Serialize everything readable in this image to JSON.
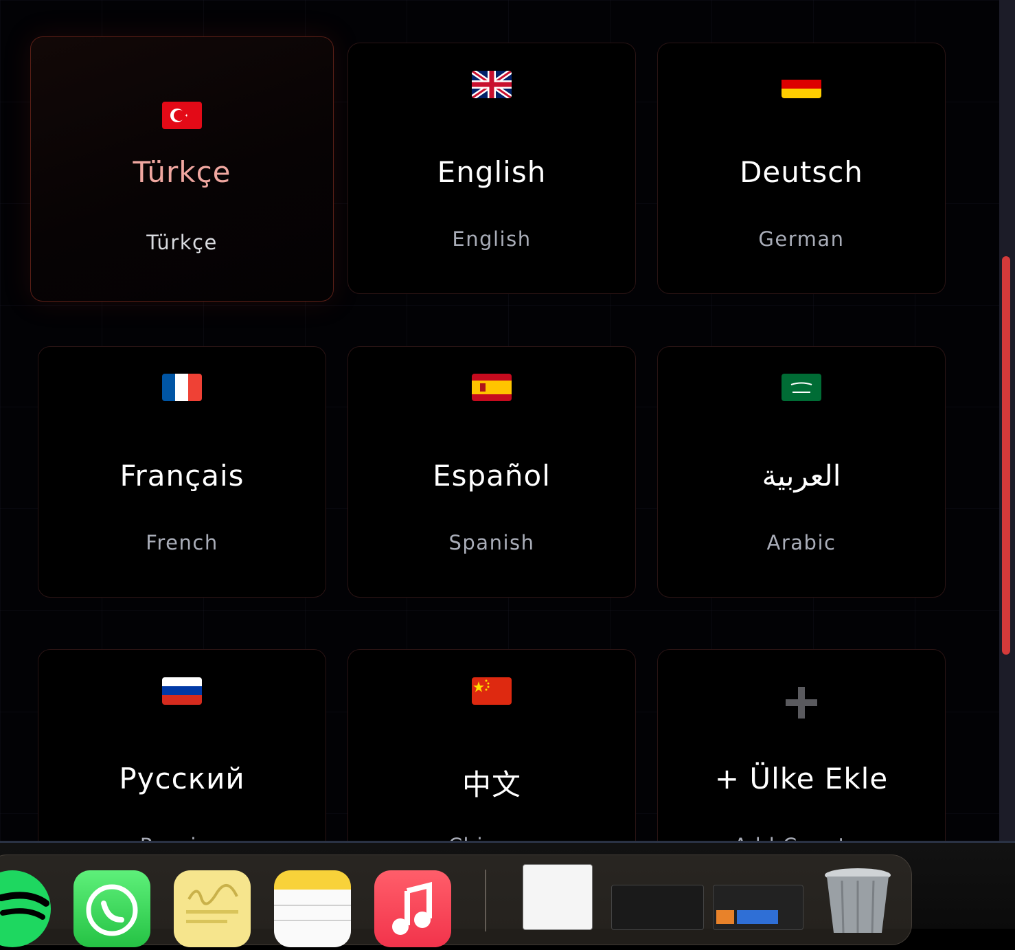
{
  "languages": [
    {
      "name": "Türkçe",
      "sub": "Türkçe",
      "flag": "turkey-flag-icon",
      "selected": true
    },
    {
      "name": "English",
      "sub": "English",
      "flag": "uk-flag-icon",
      "selected": false
    },
    {
      "name": "Deutsch",
      "sub": "German",
      "flag": "germany-flag-icon",
      "selected": false
    },
    {
      "name": "Français",
      "sub": "French",
      "flag": "france-flag-icon",
      "selected": false
    },
    {
      "name": "Español",
      "sub": "Spanish",
      "flag": "spain-flag-icon",
      "selected": false
    },
    {
      "name": "العربية",
      "sub": "Arabic",
      "flag": "saudi-arabia-flag-icon",
      "selected": false
    },
    {
      "name": "Русский",
      "sub": "Russian",
      "flag": "russia-flag-icon",
      "selected": false
    },
    {
      "name": "中文",
      "sub": "Chinese",
      "flag": "china-flag-icon",
      "selected": false
    }
  ],
  "add_country": {
    "name": "+ Ülke Ekle",
    "sub": "Add Country",
    "icon": "plus-icon"
  },
  "colors": {
    "accent": "#d43a3a",
    "selected_text": "#f0a7a0",
    "subtitle": "#a9adb8",
    "card_border": "#2a1414"
  },
  "dock": {
    "apps": [
      "spotify-icon",
      "whatsapp-icon",
      "stickies-icon",
      "notes-icon",
      "music-icon"
    ],
    "minimized": [
      "browser-window-thumbnail",
      "code-editor-thumbnail",
      "web-app-thumbnail"
    ],
    "trash": "trash-icon"
  }
}
